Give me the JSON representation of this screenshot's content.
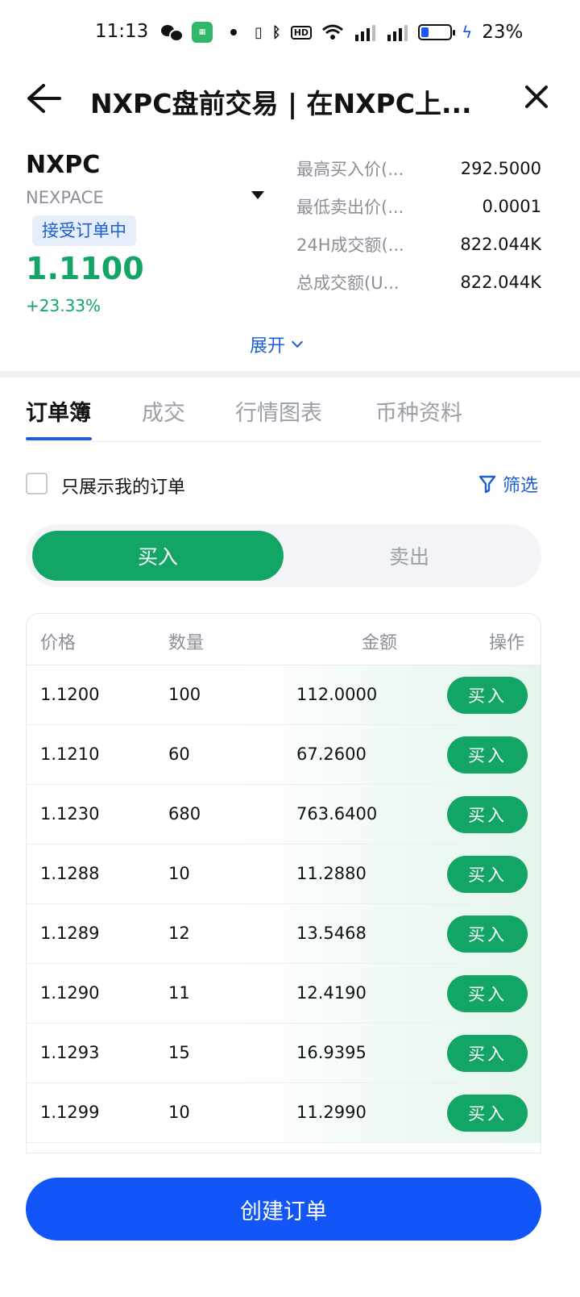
{
  "status_bar": {
    "time": "11:13",
    "battery_pct": "23%",
    "battery_level": 0.23
  },
  "header": {
    "title": "NXPC盘前交易 | 在NXPC上..."
  },
  "asset": {
    "symbol": "NXPC",
    "name": "NEXPACE",
    "status": "接受订单中",
    "price": "1.1100",
    "change": "+23.33%"
  },
  "stats": [
    {
      "label": "最高买入价(...",
      "value": "292.5000"
    },
    {
      "label": "最低卖出价(...",
      "value": "0.0001"
    },
    {
      "label": "24H成交额(...",
      "value": "822.044K"
    },
    {
      "label": "总成交额(U...",
      "value": "822.044K"
    }
  ],
  "expand_label": "展开",
  "tabs": [
    "订单簿",
    "成交",
    "行情图表",
    "币种资料"
  ],
  "active_tab": "订单簿",
  "filter": {
    "only_mine_label": "只展示我的订单",
    "filter_label": "筛选",
    "only_mine_checked": false
  },
  "side_toggle": {
    "buy_label": "买入",
    "sell_label": "卖出",
    "selected": "买入"
  },
  "order_table": {
    "headers": {
      "price": "价格",
      "qty": "数量",
      "amount": "金额",
      "action": "操作"
    },
    "action_label": "买入",
    "rows": [
      {
        "price": "1.1200",
        "qty": "100",
        "amount": "112.0000"
      },
      {
        "price": "1.1210",
        "qty": "60",
        "amount": "67.2600"
      },
      {
        "price": "1.1230",
        "qty": "680",
        "amount": "763.6400"
      },
      {
        "price": "1.1288",
        "qty": "10",
        "amount": "11.2880"
      },
      {
        "price": "1.1289",
        "qty": "12",
        "amount": "13.5468"
      },
      {
        "price": "1.1290",
        "qty": "11",
        "amount": "12.4190"
      },
      {
        "price": "1.1293",
        "qty": "15",
        "amount": "16.9395"
      },
      {
        "price": "1.1299",
        "qty": "10",
        "amount": "11.2990"
      }
    ]
  },
  "create_order_label": "创建订单",
  "colors": {
    "green": "#12a566",
    "blue": "#1256f8",
    "link": "#1d5fd0"
  },
  "icons": [
    "back-arrow-icon",
    "close-icon",
    "dropdown-triangle-icon",
    "chevron-down-icon",
    "funnel-icon",
    "wechat-icon",
    "vibrate-icon",
    "bluetooth-icon",
    "wifi-icon",
    "signal-icon",
    "battery-icon",
    "charging-bolt-icon"
  ]
}
